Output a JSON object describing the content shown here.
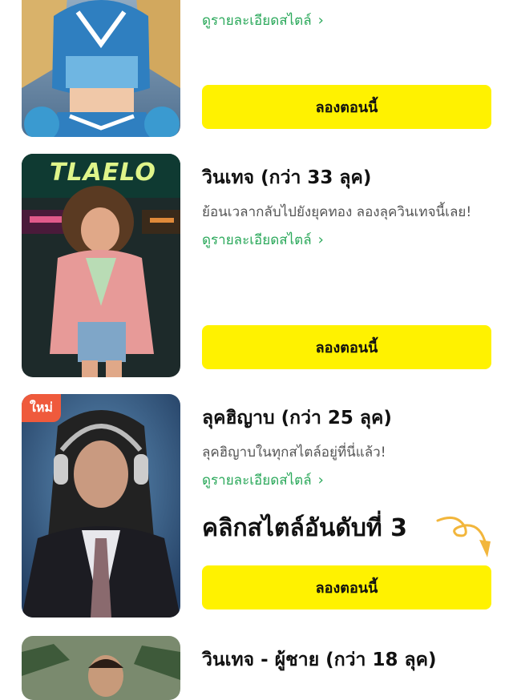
{
  "cards": [
    {
      "title": "",
      "description": "",
      "details_link": "ดูรายละเอียดสไตล์",
      "try_button": "ลองตอนนี้",
      "badge": ""
    },
    {
      "title": "วินเทจ (กว่า 33 ลุค)",
      "description": "ย้อนเวลากลับไปยังยุคทอง ลองลุควินเทจนี้เลย!",
      "details_link": "ดูรายละเอียดสไตล์",
      "try_button": "ลองตอนนี้",
      "thumb_sign": "TLAELO",
      "badge": ""
    },
    {
      "title": "ลุคฮิญาบ (กว่า 25 ลุค)",
      "description": "ลุคฮิญาบในทุกสไตล์อยู่ที่นี่แล้ว!",
      "details_link": "ดูรายละเอียดสไตล์",
      "try_button": "ลองตอนนี้",
      "badge": "ใหม่",
      "rank_callout": "คลิกสไตล์อันดับที่ 3"
    },
    {
      "title": "วินเทจ - ผู้ชาย (กว่า 18 ลุค)",
      "description": "",
      "details_link": "",
      "try_button": "",
      "badge": ""
    }
  ],
  "colors": {
    "accent_yellow": "#fff200",
    "link_green": "#2aa85a",
    "badge_red": "#ef5a3c",
    "arrow_orange": "#f2b63c"
  },
  "icons": {
    "chevron": "chevron-right-icon",
    "callout_arrow": "curly-arrow-icon"
  }
}
